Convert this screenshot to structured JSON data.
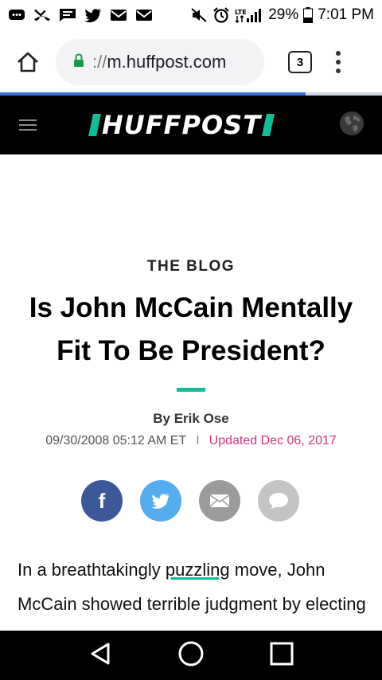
{
  "status_bar": {
    "battery_percent": "29%",
    "time": "7:01 PM",
    "network": "LTE",
    "icons": [
      "message-icon",
      "missed-call-icon",
      "chat-icon",
      "twitter-icon",
      "gmail-icon",
      "gmail-icon",
      "mute-icon",
      "alarm-icon",
      "signal-icon",
      "battery-icon"
    ]
  },
  "browser": {
    "url_scheme": "://",
    "url_host": "m.huffpost.com",
    "tab_count": "3",
    "progress": 0.8,
    "lock_color": "#1a9c46"
  },
  "site_header": {
    "logo_text": "HUFFPOST",
    "accent_color": "#0dbe98",
    "icons": [
      "menu-icon",
      "globe-icon"
    ]
  },
  "article": {
    "section": "THE BLOG",
    "headline": "Is John McCain Mentally Fit To Be President?",
    "byline": "By Erik Ose",
    "published": "09/30/2008 05:12 AM ET",
    "separator": "I",
    "updated": "Updated Dec 06, 2017",
    "body_before": "In a breathtakingly ",
    "body_link": "puzzling",
    "body_after": " move, John McCain showed terrible judgment by electing first to"
  },
  "share": {
    "facebook_label": "f",
    "icons": [
      "facebook-icon",
      "twitter-icon",
      "email-icon",
      "comment-icon"
    ]
  },
  "nav_bar": {
    "icons": [
      "back-icon",
      "home-icon",
      "recents-icon"
    ]
  }
}
